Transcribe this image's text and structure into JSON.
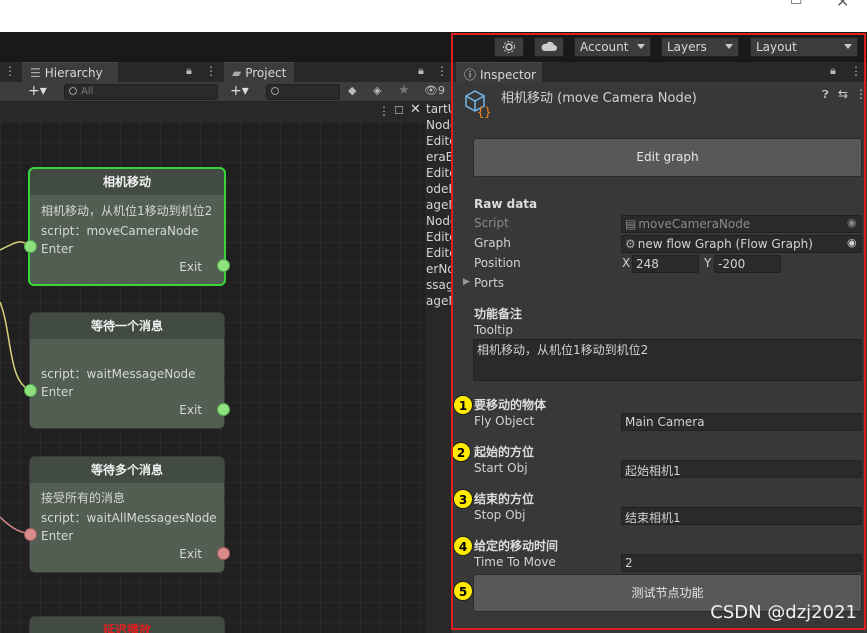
{
  "toolbar": {
    "account": "Account",
    "layers": "Layers",
    "layout": "Layout"
  },
  "hierarchy": {
    "tab": "Hierarchy",
    "search_placeholder": "All"
  },
  "project": {
    "tab": "Project",
    "hidden_count": "9"
  },
  "hierarchy_partial_items": [
    "tartU",
    "Node",
    "Edito",
    "eraE",
    "Edito",
    "odeE",
    "ageM",
    "Node",
    "Edito",
    "Edito",
    "erNo",
    "ssag",
    "ageN"
  ],
  "nodes": [
    {
      "title": "相机移动",
      "lines": [
        "相机移动，从机位1移动到机位2",
        "script：moveCameraNode"
      ],
      "enter": "Enter",
      "exit": "Exit"
    },
    {
      "title": "等待一个消息",
      "lines": [
        "",
        "script：waitMessageNode"
      ],
      "enter": "Enter",
      "exit": "Exit"
    },
    {
      "title": "等待多个消息",
      "lines": [
        "接受所有的消息",
        "script：waitAllMessagesNode"
      ],
      "enter": "Enter",
      "exit": "Exit"
    },
    {
      "title": "延迟播放"
    }
  ],
  "inspector": {
    "tab": "Inspector",
    "title": "相机移动 (move Camera Node)",
    "edit_graph": "Edit graph",
    "raw_data": "Raw data",
    "script_label": "Script",
    "script_value": "moveCameraNode",
    "graph_label": "Graph",
    "graph_value": "new flow Graph (Flow Graph)",
    "position_label": "Position",
    "x_label": "X",
    "x_value": "248",
    "y_label": "Y",
    "y_value": "-200",
    "ports_label": "Ports",
    "notes_header": "功能备注",
    "tooltip_label": "Tooltip",
    "tooltip_value": "相机移动，从机位1移动到机位2",
    "fields": [
      {
        "badge": "1",
        "header": "要移动的物体",
        "label": "Fly Object",
        "value": "Main Camera"
      },
      {
        "badge": "2",
        "header": "起始的方位",
        "label": "Start Obj",
        "value": "起始相机1"
      },
      {
        "badge": "3",
        "header": "结束的方位",
        "label": "Stop Obj",
        "value": "结束相机1"
      },
      {
        "badge": "4",
        "header": "给定的移动时间",
        "label": "Time To Move",
        "value": "2"
      }
    ],
    "test_badge": "5",
    "test_button": "测试节点功能"
  },
  "watermark": "CSDN @dzj2021",
  "colors": {
    "highlight": "#e02020",
    "selected_node": "#39d439",
    "badge": "#ffea00"
  }
}
